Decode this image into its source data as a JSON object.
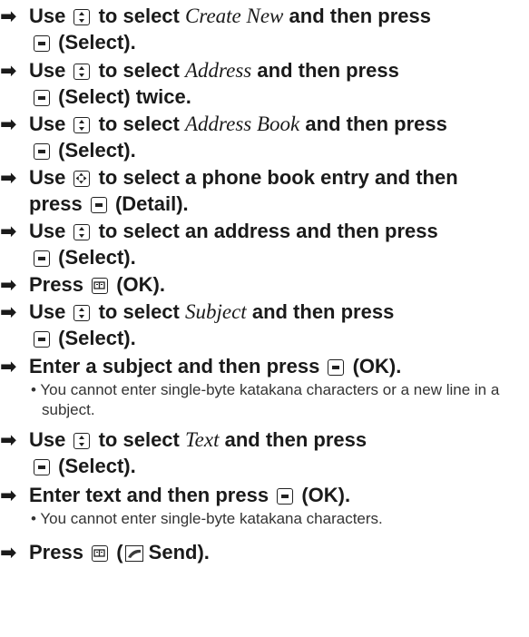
{
  "steps": [
    {
      "line1": {
        "pre": "Use",
        "key1": "updown-icon",
        "mid": "to select",
        "italic": "Create New",
        "post": "and then press"
      },
      "line2": {
        "key2": "select-key-icon",
        "post": "(Select)."
      }
    },
    {
      "line1": {
        "pre": "Use",
        "key1": "updown-icon",
        "mid": "to select",
        "italic": "Address",
        "post": "and then press"
      },
      "line2": {
        "key2": "select-key-icon",
        "post": "(Select) twice."
      }
    },
    {
      "line1": {
        "pre": "Use",
        "key1": "updown-icon",
        "mid": "to select",
        "italic": "Address Book",
        "post": "and then press"
      },
      "line2": {
        "key2": "select-key-icon",
        "post": "(Select)."
      }
    },
    {
      "line1": {
        "pre": "Use",
        "key1": "dpad-icon",
        "mid": "to select a phone book entry and then"
      },
      "line2": {
        "pre": "press",
        "key2": "select-key-icon",
        "post": "(Detail)."
      }
    },
    {
      "line1": {
        "pre": "Use",
        "key1": "updown-icon",
        "mid": "to select an address and then press"
      },
      "line2": {
        "key2": "select-key-icon",
        "post": "(Select)."
      }
    },
    {
      "line1": {
        "pre": "Press",
        "key1": "book-key-icon",
        "post": "(OK)."
      }
    },
    {
      "line1": {
        "pre": "Use",
        "key1": "updown-icon",
        "mid": "to select",
        "italic": "Subject",
        "post": "and then press"
      },
      "line2": {
        "key2": "select-key-icon",
        "post": "(Select)."
      }
    },
    {
      "line1": {
        "pre": "Enter a subject and then press",
        "key1": "select-key-icon",
        "post": "(OK)."
      },
      "note": "You cannot enter single-byte katakana characters or a new line in a subject."
    },
    {
      "line1": {
        "pre": "Use",
        "key1": "updown-icon",
        "mid": "to select",
        "italic": "Text",
        "post": "and then press"
      },
      "line2": {
        "key2": "select-key-icon",
        "post": "(Select)."
      }
    },
    {
      "line1": {
        "pre": "Enter text and then press",
        "key1": "select-key-icon",
        "post": "(OK)."
      },
      "note": "You cannot enter single-byte katakana characters."
    },
    {
      "line1": {
        "pre": "Press",
        "key1": "book-key-icon",
        "paren_open": "(",
        "icon2": "send-phone-icon",
        "post": "Send)."
      }
    }
  ],
  "bullet": "•",
  "arrow": "➡"
}
